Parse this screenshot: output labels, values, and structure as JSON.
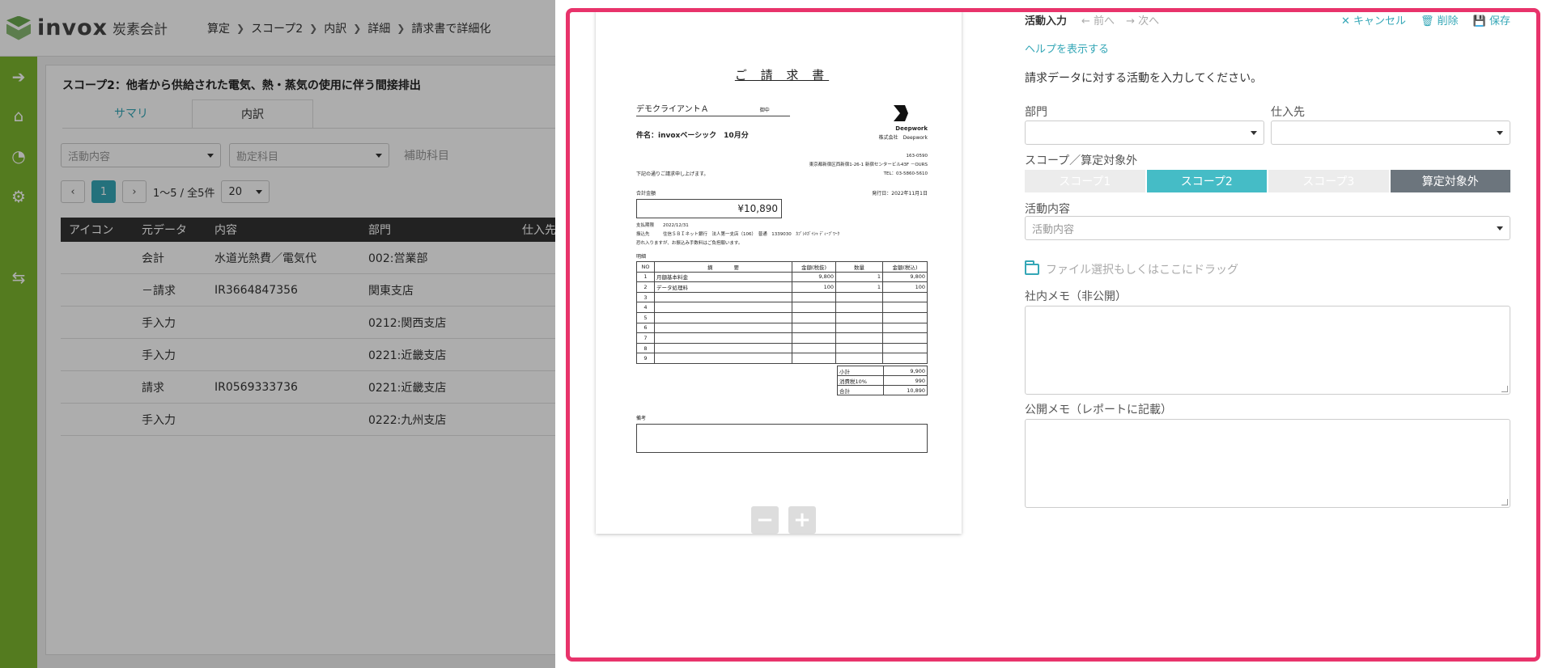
{
  "app": {
    "logo_text": "invox",
    "logo_sub": "炭素会計",
    "breadcrumb": [
      "算定",
      "スコープ2",
      "内訳",
      "詳細",
      "請求書で詳細化"
    ]
  },
  "sidebar": {
    "icons": [
      "arrow-right-circle-icon",
      "home-icon",
      "pie-chart-icon",
      "gear-icon",
      "transfer-icon"
    ]
  },
  "main": {
    "scope_title": "スコープ2：他者から供給された電気、熱・蒸気の使用に伴う間接排出",
    "tabs": [
      "サマリ",
      "内訳"
    ],
    "filters": {
      "activity": "活動内容",
      "account": "勘定科目",
      "sub_account": "補助科目"
    },
    "pager": {
      "current": "1",
      "range": "1〜5 / 全5件",
      "page_size": "20"
    },
    "table": {
      "headers": [
        "アイコン",
        "元データ",
        "内容",
        "部門",
        "仕入先"
      ],
      "rows": [
        {
          "source": "会計",
          "content": "水道光熱費／電気代",
          "dept": "002:営業部"
        },
        {
          "source": "－請求",
          "content": "IR3664847356",
          "dept": "関東支店"
        },
        {
          "source": "手入力",
          "content": "",
          "dept": "0212:関西支店"
        },
        {
          "source": "手入力",
          "content": "",
          "dept": "0221:近畿支店"
        },
        {
          "source": "請求",
          "content": "IR0569333736",
          "dept": "0221:近畿支店"
        },
        {
          "source": "手入力",
          "content": "",
          "dept": "0222:九州支店"
        }
      ]
    }
  },
  "invoice": {
    "title": "ご 請 求 書",
    "client": "デモクライアントＡ",
    "honorific": "御中",
    "subject": "件名：invoxベーシック　10月分",
    "company_name": "Deepwork",
    "company_line": "株式会社　Deepwork",
    "postal": "163-0590",
    "address": "東京都新宿区西新宿1-26-1 新宿センタービル43F －OURS",
    "tel": "TEL：03-5860-5610",
    "greeting": "下記の通りご請求申し上げます。",
    "amount_label": "合計金額",
    "issue_date": "発行日：2022年11月1日",
    "amount": "¥10,890",
    "due": "支払期限　　2022/12/31",
    "bank": "振込先　　　住信ＳＢＩネット銀行　法人第一支店（106）　普通　1339030　ｶﾌﾞｼｷｶﾞｲｼｬ ﾃﾞｨｰﾌﾟﾜｰｸ",
    "fee_note": "恐れ入りますが、お振込み手数料はご負担願います。",
    "detail_label": "明細",
    "table_headers": [
      "NO",
      "摘　　　　要",
      "金額(税抜)",
      "数量",
      "金額(税込)"
    ],
    "items": [
      {
        "no": "1",
        "desc": "月額基本料金",
        "price": "9,800",
        "qty": "1",
        "total": "9,800"
      },
      {
        "no": "2",
        "desc": "データ処理料",
        "price": "100",
        "qty": "1",
        "total": "100"
      },
      {
        "no": "3",
        "desc": "",
        "price": "",
        "qty": "",
        "total": ""
      },
      {
        "no": "4",
        "desc": "",
        "price": "",
        "qty": "",
        "total": ""
      },
      {
        "no": "5",
        "desc": "",
        "price": "",
        "qty": "",
        "total": ""
      },
      {
        "no": "6",
        "desc": "",
        "price": "",
        "qty": "",
        "total": ""
      },
      {
        "no": "7",
        "desc": "",
        "price": "",
        "qty": "",
        "total": ""
      },
      {
        "no": "8",
        "desc": "",
        "price": "",
        "qty": "",
        "total": ""
      },
      {
        "no": "9",
        "desc": "",
        "price": "",
        "qty": "",
        "total": ""
      }
    ],
    "summary": [
      {
        "label": "小計",
        "value": "9,900"
      },
      {
        "label": "消費税10%",
        "value": "990"
      },
      {
        "label": "合計",
        "value": "10,890"
      }
    ],
    "note_label": "備考"
  },
  "zoom": {
    "out": "−",
    "in": "+"
  },
  "form": {
    "title": "活動入力",
    "prev": "前へ",
    "next": "次へ",
    "cancel": "キャンセル",
    "delete": "削除",
    "save": "保存",
    "help": "ヘルプを表示する",
    "instruction": "請求データに対する活動を入力してください。",
    "dept_label": "部門",
    "supplier_label": "仕入先",
    "scope_label": "スコープ／算定対象外",
    "scopes": [
      "スコープ1",
      "スコープ2",
      "スコープ3",
      "算定対象外"
    ],
    "activity_label": "活動内容",
    "activity_placeholder": "活動内容",
    "file_drop": "ファイル選択もしくはここにドラッグ",
    "internal_memo_label": "社内メモ（非公開）",
    "public_memo_label": "公開メモ（レポートに記載）"
  },
  "colors": {
    "accent": "#35a7b7",
    "sidebar": "#7cb62e",
    "highlight": "#e8336b",
    "scope_on": "#45bcc6",
    "excluded": "#6c757d"
  }
}
